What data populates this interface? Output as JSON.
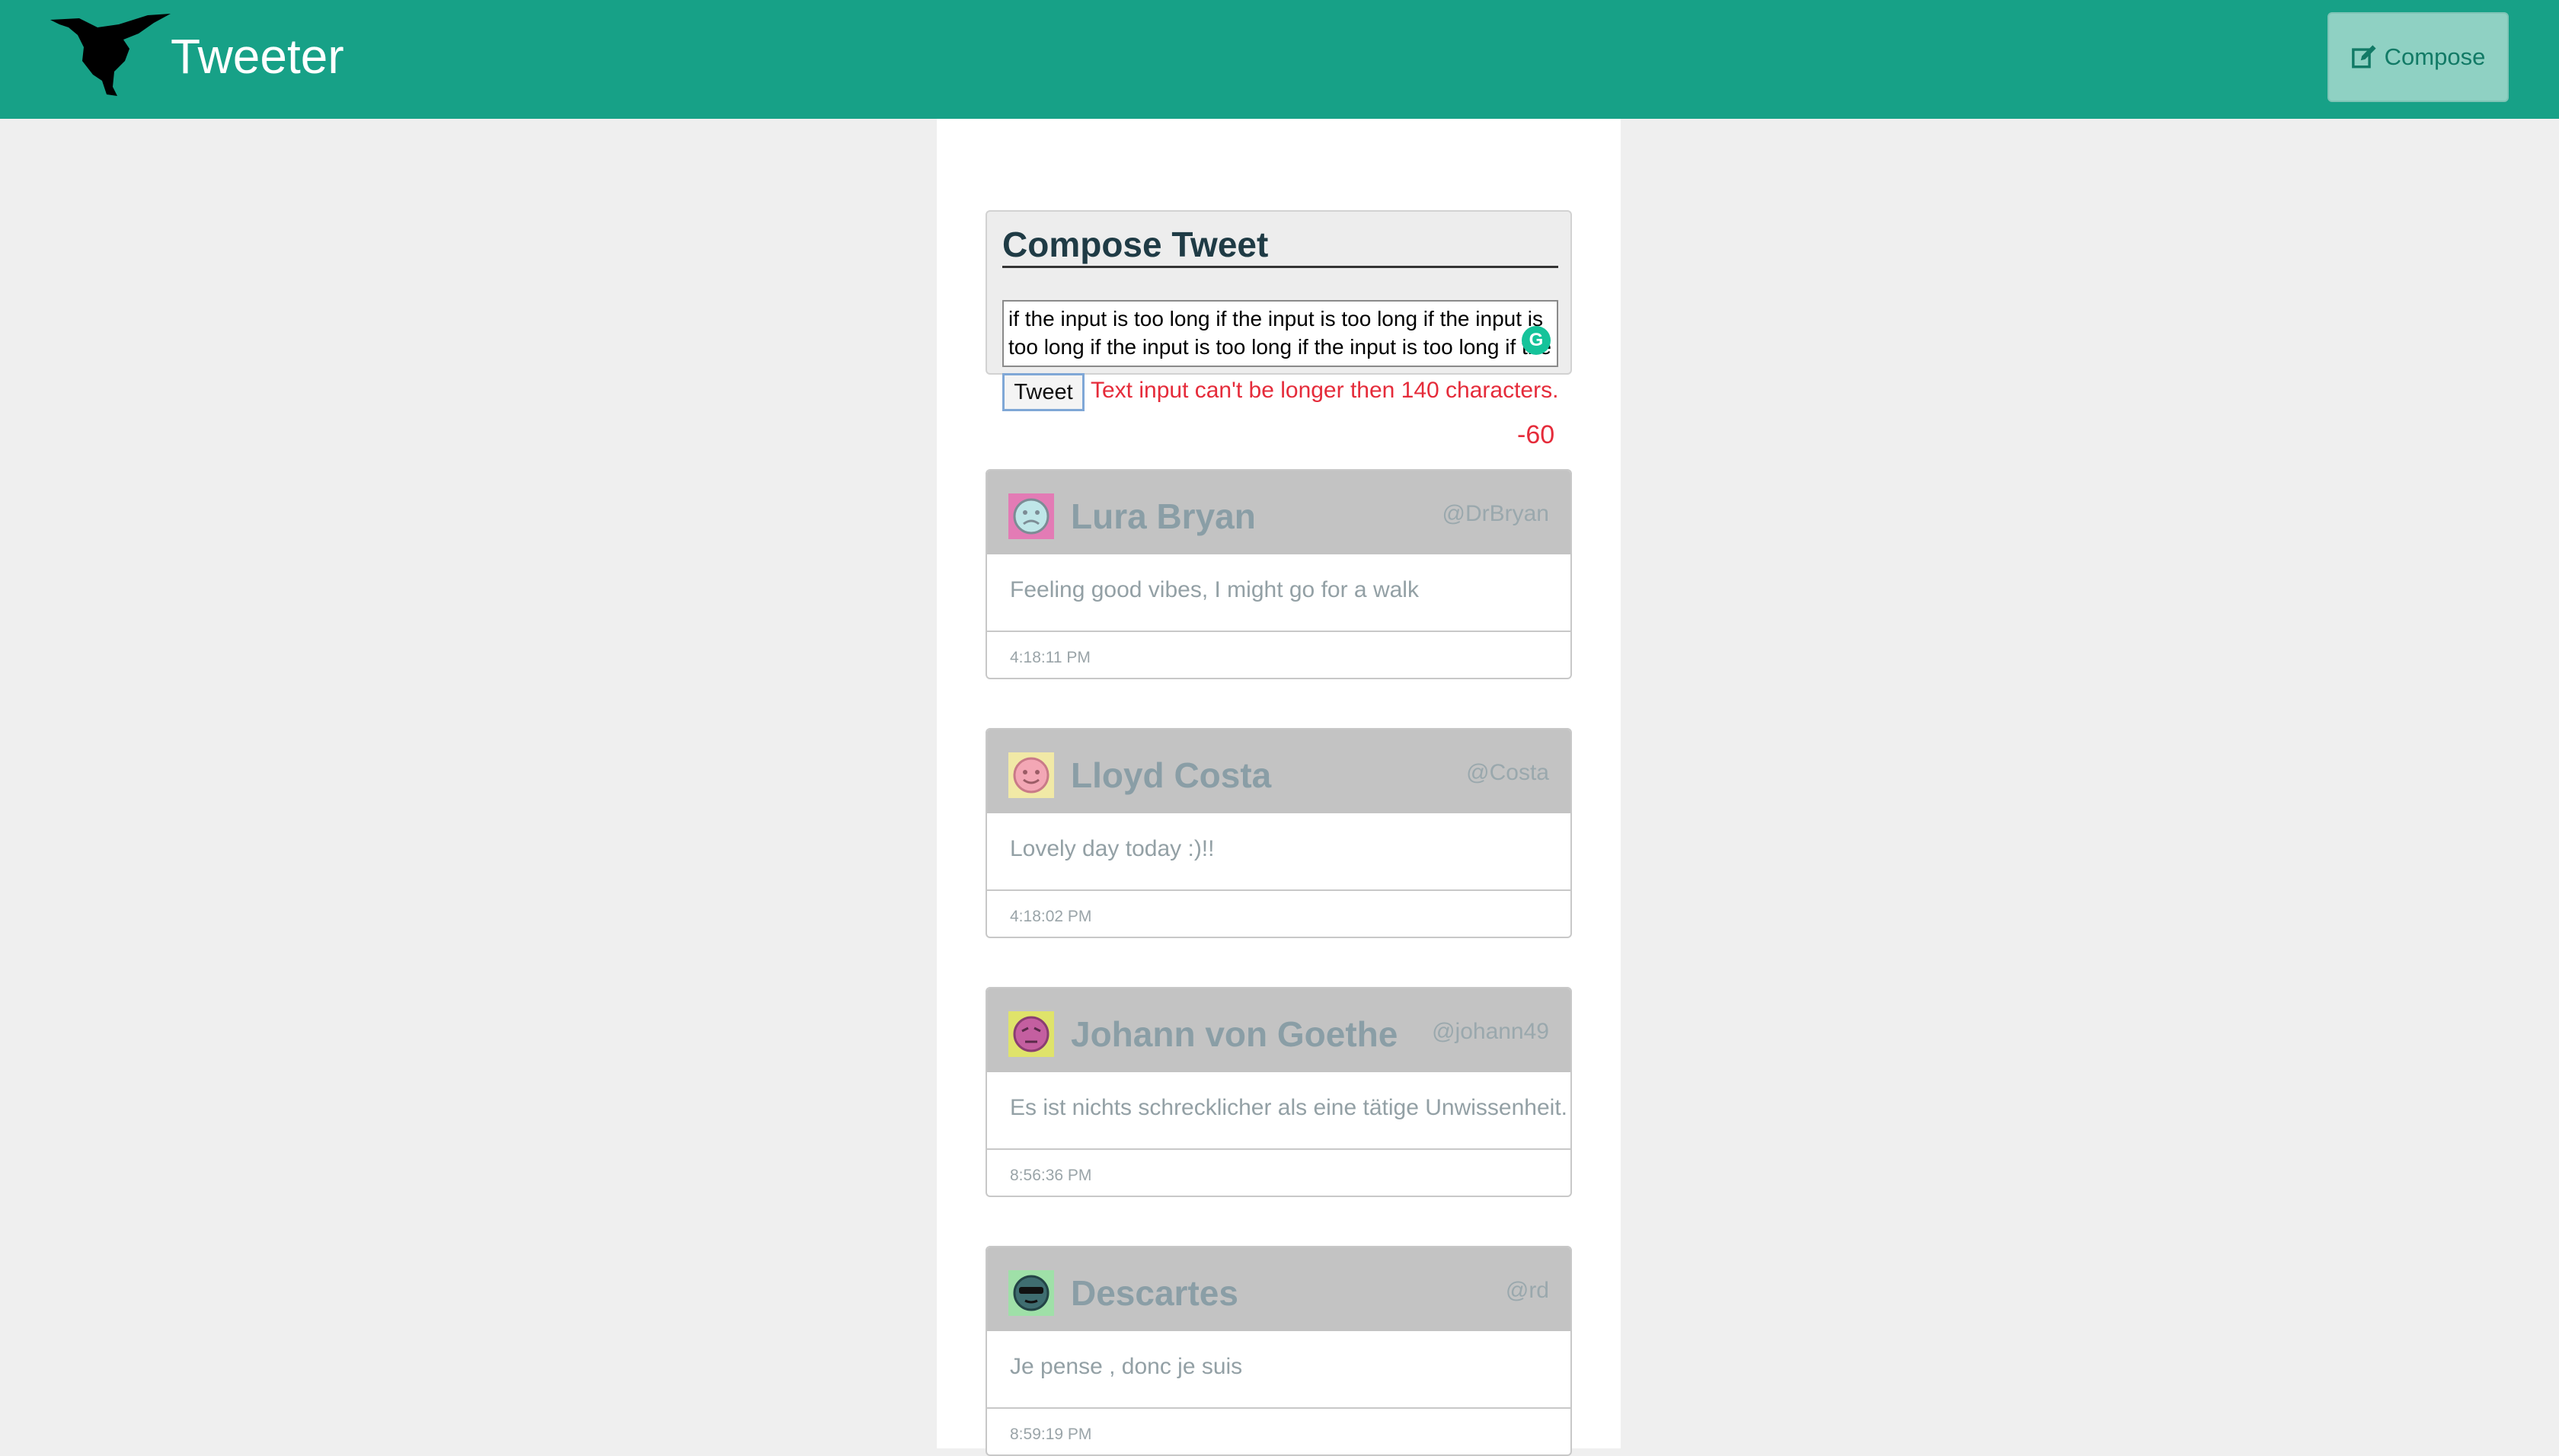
{
  "header": {
    "brand": "Tweeter",
    "compose_label": "Compose"
  },
  "composer": {
    "title": "Compose Tweet",
    "input_value": "if the input is too long if the input is too long if the input is too long if the input is too long if the input is too long if the input is too long if",
    "tweet_button": "Tweet",
    "error": "Text input can't be longer then 140 characters.",
    "counter": "-60"
  },
  "tweets": [
    {
      "name": "Lura Bryan",
      "handle": "@DrBryan",
      "text": "Feeling good vibes, I might go for a walk",
      "time": "4:18:11 PM"
    },
    {
      "name": "Lloyd Costa",
      "handle": "@Costa",
      "text": "Lovely day today :)!!",
      "time": "4:18:02 PM"
    },
    {
      "name": "Johann von Goethe",
      "handle": "@johann49",
      "text": "Es ist nichts schrecklicher als eine tätige Unwissenheit.",
      "time": "8:56:36 PM"
    },
    {
      "name": "Descartes",
      "handle": "@rd",
      "text": "Je pense , donc je suis",
      "time": "8:59:19 PM"
    }
  ],
  "colors": {
    "header_bg": "#17a187",
    "error": "#e52b3a",
    "tweet_header_bg": "#c3c3c3"
  },
  "icons": {
    "logo": "hummingbird-icon",
    "compose": "edit-icon",
    "grammarly": "grammarly-icon"
  }
}
